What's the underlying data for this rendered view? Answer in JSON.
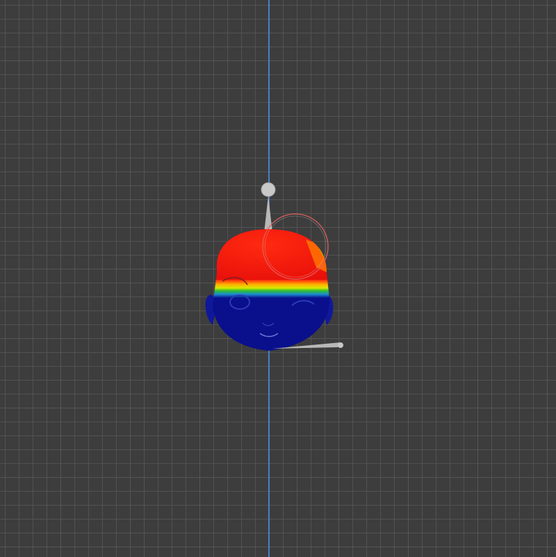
{
  "viewport": {
    "mode": "weight-paint",
    "background_color": "#3d3d3d",
    "grid_color": "#525252",
    "axis_color": "#4a7fc4"
  },
  "mesh": {
    "name_icon": "head-mesh",
    "weight_high_color": "#ff1a0a",
    "weight_low_color": "#0a0f8c"
  },
  "bones": [
    {
      "icon": "bone-head"
    },
    {
      "icon": "bone-jaw"
    }
  ],
  "brush": {
    "icon": "brush-cursor",
    "color": "#e06060"
  }
}
